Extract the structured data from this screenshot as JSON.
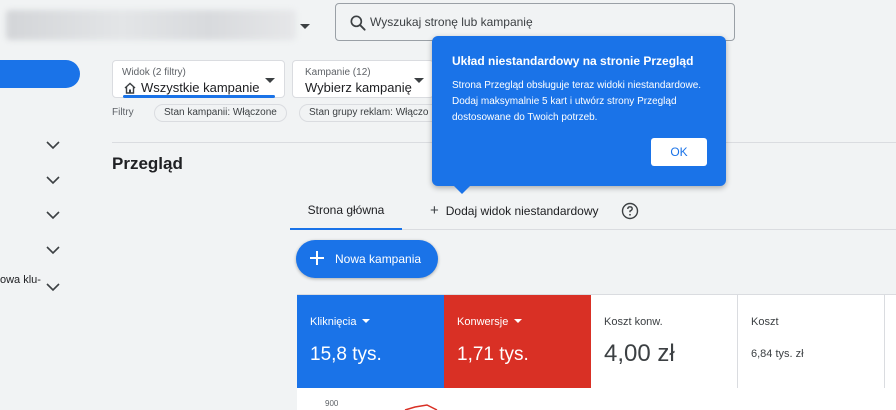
{
  "search": {
    "placeholder": "Wyszukaj stronę lub kampanię"
  },
  "sidebar": {
    "truncated_label": "owa klu-"
  },
  "filters": {
    "view_caption": "Widok (2 filtry)",
    "view_value": "Wszystkie kampanie",
    "campaign_caption": "Kampanie (12)",
    "campaign_value": "Wybierz kampanię",
    "label": "Filtry",
    "chips": [
      "Stan kampanii: Włączone",
      "Stan grupy reklam: Włączo"
    ]
  },
  "page": {
    "title": "Przegląd"
  },
  "tabs": {
    "home": "Strona główna",
    "add_view": "Dodaj widok niestandardowy"
  },
  "new_campaign_label": "Nowa kampania",
  "scorecards": [
    {
      "metric": "Kliknięcia",
      "value": "15,8 tys."
    },
    {
      "metric": "Konwersje",
      "value": "1,71 tys."
    },
    {
      "metric": "Koszt konw.",
      "value": "4,00 zł"
    },
    {
      "metric": "Koszt",
      "value": "6,84 tys. zł"
    }
  ],
  "chart": {
    "y_tick": "900"
  },
  "tooltip": {
    "title": "Układ niestandardowy na stronie Przegląd",
    "body": "Strona Przegląd obsługuje teraz widoki niestandardowe. Dodaj maksymalnie 5 kart i utwórz strony Przegląd dostosowane do Twoich potrzeb.",
    "ok_label": "OK"
  },
  "colors": {
    "accent": "#1a73e8",
    "conversions": "#d93025"
  },
  "icons": [
    "search-icon",
    "home-icon",
    "chevron-down-icon",
    "plus-icon",
    "help-icon"
  ]
}
